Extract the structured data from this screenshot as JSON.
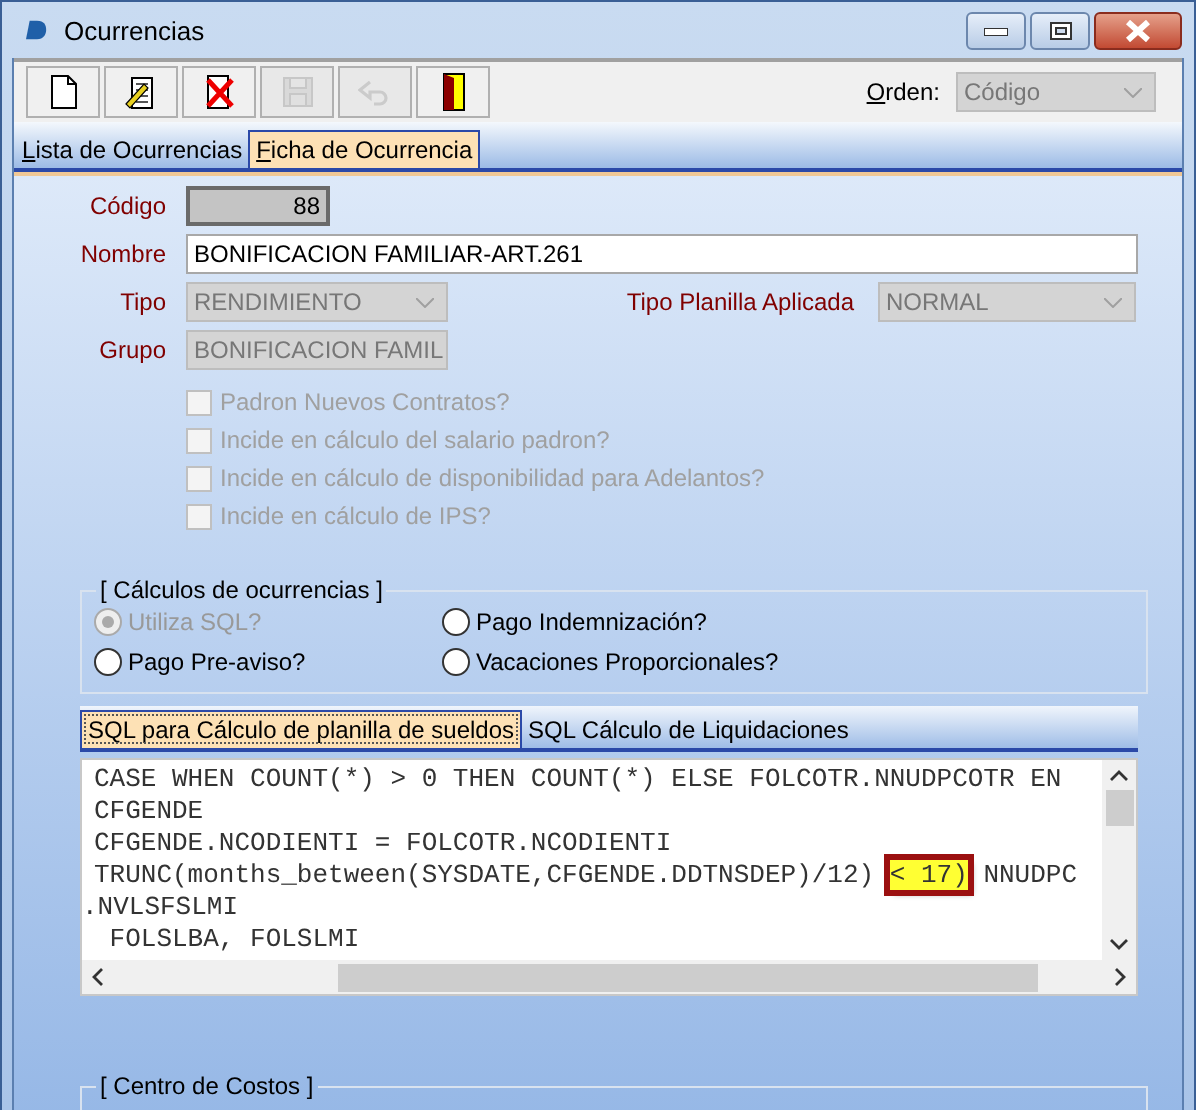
{
  "window": {
    "title": "Ocurrencias"
  },
  "toolbar": [
    {
      "disabled": false
    },
    {
      "disabled": false
    },
    {
      "disabled": false
    },
    {
      "disabled": true
    },
    {
      "disabled": true
    },
    {
      "disabled": false
    }
  ],
  "order": {
    "label": "Orden:",
    "value": "Código",
    "disabled": true
  },
  "tabs": [
    {
      "label": "Lista de Ocurrencias",
      "selected": false
    },
    {
      "label": "Ficha de Ocurrencia",
      "selected": true
    }
  ],
  "form": {
    "codigo": {
      "label": "Código",
      "value": "88"
    },
    "nombre": {
      "label": "Nombre",
      "value": "BONIFICACION FAMILIAR-ART.261"
    },
    "tipo": {
      "label": "Tipo",
      "value": "RENDIMIENTO",
      "disabled": true
    },
    "tipo_planilla": {
      "label": "Tipo Planilla Aplicada",
      "value": "NORMAL",
      "disabled": true
    },
    "grupo": {
      "label": "Grupo",
      "value": "BONIFICACION FAMIL",
      "disabled": true
    }
  },
  "checkboxes": [
    {
      "label": "Padron Nuevos Contratos?",
      "checked": false,
      "disabled": true
    },
    {
      "label": "Incide en cálculo del salario padron?",
      "checked": false,
      "disabled": true
    },
    {
      "label": "Incide en cálculo de disponibilidad para Adelantos?",
      "checked": false,
      "disabled": true
    },
    {
      "label": "Incide en cálculo de IPS?",
      "checked": false,
      "disabled": true
    }
  ],
  "calculos": {
    "title": "[ Cálculos de ocurrencias ]",
    "options": [
      {
        "label": "Utiliza SQL?",
        "selected": true,
        "disabled": true
      },
      {
        "label": "Pago Indemnización?",
        "selected": false,
        "disabled": false
      },
      {
        "label": "Pago Pre-aviso?",
        "selected": false,
        "disabled": false
      },
      {
        "label": "Vacaciones Proporcionales?",
        "selected": false,
        "disabled": false
      }
    ]
  },
  "sql_tabs": [
    {
      "label": "SQL para Cálculo de planilla de sueldos",
      "selected": true
    },
    {
      "label": "SQL Cálculo de Liquidaciones",
      "selected": false
    }
  ],
  "sql_lines": [
    {
      "kind": "plain",
      "text": "CASE WHEN COUNT(*) > 0 THEN COUNT(*) ELSE FOLCOTR.NNUDPCOTR EN"
    },
    {
      "kind": "plain",
      "text": "CFGENDE"
    },
    {
      "kind": "plain",
      "text": "CFGENDE.NCODIENTI = FOLCOTR.NCODIENTI"
    },
    {
      "kind": "highlight",
      "before": "TRUNC(months_between(SYSDATE,CFGENDE.DDTNSDEP)/12) ",
      "highlighted": "< 17)",
      "after": " NNUDPC"
    },
    {
      "kind": "cut",
      "text": ".NVLSFSLMI"
    },
    {
      "kind": "plain",
      "text": " FOLSLBA, FOLSLMI"
    }
  ],
  "centro_costos": {
    "title": "[ Centro de Costos ]"
  }
}
